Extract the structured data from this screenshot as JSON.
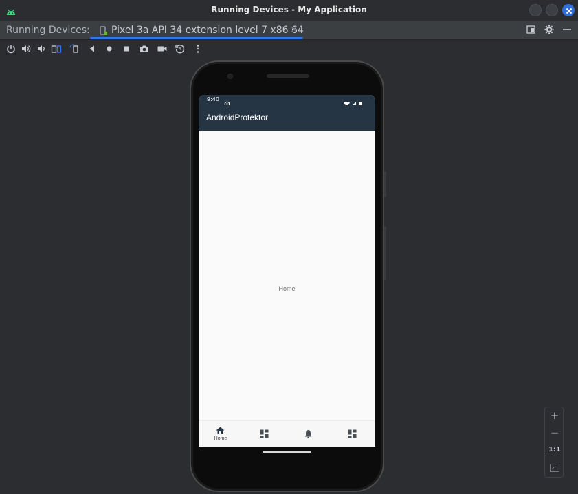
{
  "window": {
    "title": "Running Devices - My Application",
    "app_icon": "android-icon",
    "controls": [
      "minimize-icon",
      "maximize-icon",
      "close-icon"
    ]
  },
  "panel": {
    "label": "Running Devices:",
    "tab": {
      "icon": "device-icon",
      "label": "Pixel 3a API 34 extension level 7 x86 64",
      "close": "×"
    },
    "actions": [
      "window-mode-icon",
      "settings-icon",
      "hide-icon"
    ]
  },
  "toolbar": {
    "buttons": [
      "power-icon",
      "volume-up-icon",
      "volume-down-icon",
      "rotate-left-icon",
      "rotate-right-icon",
      "back-icon",
      "home-icon",
      "overview-icon",
      "screenshot-icon",
      "screen-record-icon",
      "reset-icon",
      "more-icon"
    ]
  },
  "device": {
    "status_bar": {
      "time": "9:40"
    },
    "app_bar": {
      "title": "AndroidProtektor"
    },
    "content": {
      "text": "Home"
    },
    "bottom_nav": {
      "items": [
        {
          "icon": "home-icon",
          "label": "Home",
          "selected": true
        },
        {
          "icon": "dashboard-icon",
          "label": "",
          "selected": false
        },
        {
          "icon": "notifications-icon",
          "label": "",
          "selected": false
        },
        {
          "icon": "dashboard-icon",
          "label": "",
          "selected": false
        }
      ]
    }
  },
  "zoom": {
    "zoom_in": "+",
    "zoom_out": "−",
    "actual_size": "1:1",
    "fit": "fit-screen-icon"
  },
  "colors": {
    "app_bar": "#253544",
    "accent": "#3574f0",
    "ide_background": "#2b2d30",
    "android_green": "#3ddc84"
  }
}
